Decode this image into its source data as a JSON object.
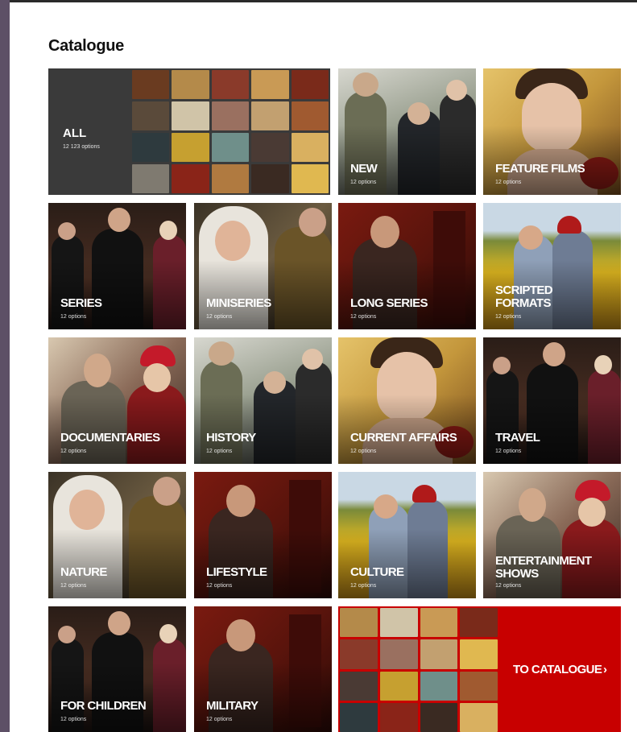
{
  "catalogue": {
    "title": "Catalogue",
    "all": {
      "label": "ALL",
      "sub": "12 123 options"
    },
    "tiles": [
      {
        "label": "NEW",
        "sub": "12 options"
      },
      {
        "label": "FEATURE FILMS",
        "sub": "12 options"
      },
      {
        "label": "SERIES",
        "sub": "12 options"
      },
      {
        "label": "MINISERIES",
        "sub": "12 options"
      },
      {
        "label": "LONG SERIES",
        "sub": "12 options"
      },
      {
        "label": "SCRIPTED FORMATS",
        "sub": "12 options"
      },
      {
        "label": "DOCUMENTARIES",
        "sub": "12 options"
      },
      {
        "label": "HISTORY",
        "sub": "12 options"
      },
      {
        "label": "CURRENT AFFAIRS",
        "sub": "12 options"
      },
      {
        "label": "TRAVEL",
        "sub": "12 options"
      },
      {
        "label": "NATURE",
        "sub": "12 options"
      },
      {
        "label": "LIFESTYLE",
        "sub": "12 options"
      },
      {
        "label": "CULTURE",
        "sub": "12 options"
      },
      {
        "label": "ENTERTAINMENT SHOWS",
        "sub": "12 options"
      },
      {
        "label": "FOR CHILDREN",
        "sub": "12 options"
      },
      {
        "label": "MILITARY",
        "sub": "12 options"
      }
    ],
    "to_catalogue": {
      "label": "TO CATALOGUE",
      "arrow": "›",
      "icon": "chevron-right-icon"
    }
  }
}
